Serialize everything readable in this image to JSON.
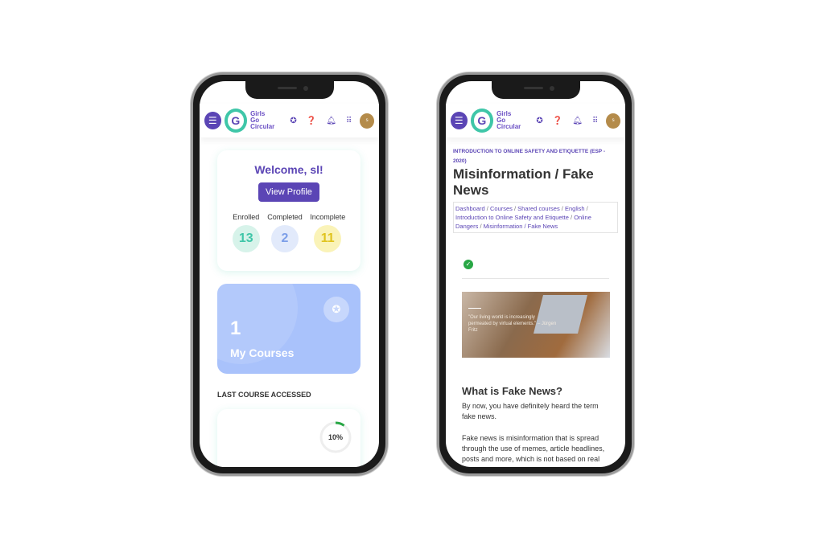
{
  "brand": {
    "line1": "Girls",
    "line2": "Go",
    "line3": "Circular",
    "logo_letter": "G",
    "avatar": "s"
  },
  "left": {
    "welcome": "Welcome, sl!",
    "view_profile": "View Profile",
    "stats": [
      {
        "label": "Enrolled",
        "value": "13",
        "color": "#3fc6a8",
        "bg": "#d7f3ea"
      },
      {
        "label": "Completed",
        "value": "2",
        "color": "#7c9ee8",
        "bg": "#e2eafb"
      },
      {
        "label": "Incomplete",
        "value": "11",
        "color": "#e0c41e",
        "bg": "#faf3b8"
      }
    ],
    "courses_count": "1",
    "courses_label": "My Courses",
    "last_course_heading": "LAST COURSE ACCESSED",
    "progress": "10%",
    "progress_value": 10
  },
  "right": {
    "course_title": "INTRODUCTION TO ONLINE SAFETY AND ETIQUETTE (ESP - 2020)",
    "page_title": "Misinformation / Fake News",
    "breadcrumbs": [
      "Dashboard",
      "Courses",
      "Shared courses",
      "English",
      "Introduction to Online Safety and Etiquette",
      "Online Dangers",
      "Misinformation / Fake News"
    ],
    "image_quote": "\"Our living world is increasingly permeated by virtual elements.\" – Jürgen Fritz",
    "section_heading": "What is Fake News?",
    "para1": "By now, you have definitely heard the term fake news.",
    "para2": "Fake news is misinformation that is spread through the use of memes, article headlines, posts and more, which is not based on real facts."
  },
  "colors": {
    "primary": "#5b45b5",
    "teal": "#3fc6a8",
    "courses_card": "#a9c2fb",
    "check": "#28a745"
  }
}
